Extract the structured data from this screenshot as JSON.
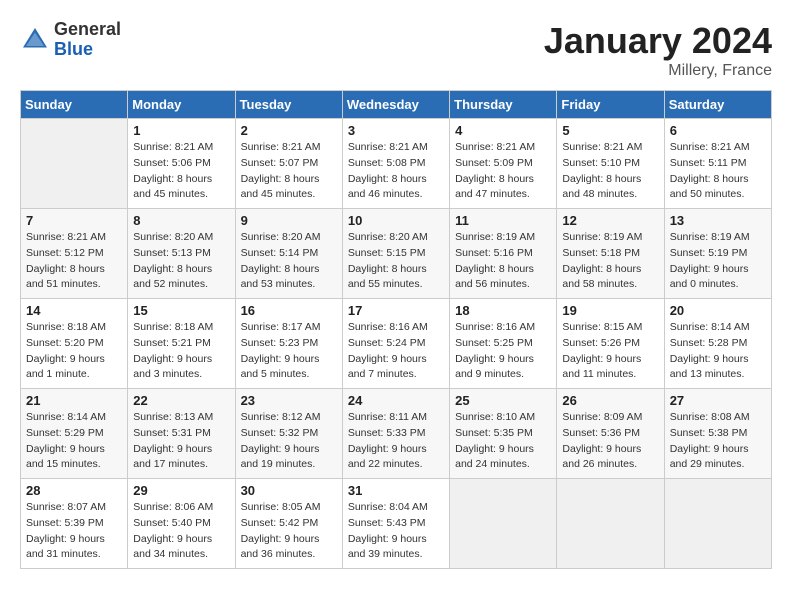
{
  "header": {
    "logo_general": "General",
    "logo_blue": "Blue",
    "month_title": "January 2024",
    "location": "Millery, France"
  },
  "columns": [
    "Sunday",
    "Monday",
    "Tuesday",
    "Wednesday",
    "Thursday",
    "Friday",
    "Saturday"
  ],
  "weeks": [
    [
      {
        "day": "",
        "empty": true
      },
      {
        "day": "1",
        "sunrise": "8:21 AM",
        "sunset": "5:06 PM",
        "daylight": "8 hours and 45 minutes."
      },
      {
        "day": "2",
        "sunrise": "8:21 AM",
        "sunset": "5:07 PM",
        "daylight": "8 hours and 45 minutes."
      },
      {
        "day": "3",
        "sunrise": "8:21 AM",
        "sunset": "5:08 PM",
        "daylight": "8 hours and 46 minutes."
      },
      {
        "day": "4",
        "sunrise": "8:21 AM",
        "sunset": "5:09 PM",
        "daylight": "8 hours and 47 minutes."
      },
      {
        "day": "5",
        "sunrise": "8:21 AM",
        "sunset": "5:10 PM",
        "daylight": "8 hours and 48 minutes."
      },
      {
        "day": "6",
        "sunrise": "8:21 AM",
        "sunset": "5:11 PM",
        "daylight": "8 hours and 50 minutes."
      }
    ],
    [
      {
        "day": "7",
        "sunrise": "8:21 AM",
        "sunset": "5:12 PM",
        "daylight": "8 hours and 51 minutes."
      },
      {
        "day": "8",
        "sunrise": "8:20 AM",
        "sunset": "5:13 PM",
        "daylight": "8 hours and 52 minutes."
      },
      {
        "day": "9",
        "sunrise": "8:20 AM",
        "sunset": "5:14 PM",
        "daylight": "8 hours and 53 minutes."
      },
      {
        "day": "10",
        "sunrise": "8:20 AM",
        "sunset": "5:15 PM",
        "daylight": "8 hours and 55 minutes."
      },
      {
        "day": "11",
        "sunrise": "8:19 AM",
        "sunset": "5:16 PM",
        "daylight": "8 hours and 56 minutes."
      },
      {
        "day": "12",
        "sunrise": "8:19 AM",
        "sunset": "5:18 PM",
        "daylight": "8 hours and 58 minutes."
      },
      {
        "day": "13",
        "sunrise": "8:19 AM",
        "sunset": "5:19 PM",
        "daylight": "9 hours and 0 minutes."
      }
    ],
    [
      {
        "day": "14",
        "sunrise": "8:18 AM",
        "sunset": "5:20 PM",
        "daylight": "9 hours and 1 minute."
      },
      {
        "day": "15",
        "sunrise": "8:18 AM",
        "sunset": "5:21 PM",
        "daylight": "9 hours and 3 minutes."
      },
      {
        "day": "16",
        "sunrise": "8:17 AM",
        "sunset": "5:23 PM",
        "daylight": "9 hours and 5 minutes."
      },
      {
        "day": "17",
        "sunrise": "8:16 AM",
        "sunset": "5:24 PM",
        "daylight": "9 hours and 7 minutes."
      },
      {
        "day": "18",
        "sunrise": "8:16 AM",
        "sunset": "5:25 PM",
        "daylight": "9 hours and 9 minutes."
      },
      {
        "day": "19",
        "sunrise": "8:15 AM",
        "sunset": "5:26 PM",
        "daylight": "9 hours and 11 minutes."
      },
      {
        "day": "20",
        "sunrise": "8:14 AM",
        "sunset": "5:28 PM",
        "daylight": "9 hours and 13 minutes."
      }
    ],
    [
      {
        "day": "21",
        "sunrise": "8:14 AM",
        "sunset": "5:29 PM",
        "daylight": "9 hours and 15 minutes."
      },
      {
        "day": "22",
        "sunrise": "8:13 AM",
        "sunset": "5:31 PM",
        "daylight": "9 hours and 17 minutes."
      },
      {
        "day": "23",
        "sunrise": "8:12 AM",
        "sunset": "5:32 PM",
        "daylight": "9 hours and 19 minutes."
      },
      {
        "day": "24",
        "sunrise": "8:11 AM",
        "sunset": "5:33 PM",
        "daylight": "9 hours and 22 minutes."
      },
      {
        "day": "25",
        "sunrise": "8:10 AM",
        "sunset": "5:35 PM",
        "daylight": "9 hours and 24 minutes."
      },
      {
        "day": "26",
        "sunrise": "8:09 AM",
        "sunset": "5:36 PM",
        "daylight": "9 hours and 26 minutes."
      },
      {
        "day": "27",
        "sunrise": "8:08 AM",
        "sunset": "5:38 PM",
        "daylight": "9 hours and 29 minutes."
      }
    ],
    [
      {
        "day": "28",
        "sunrise": "8:07 AM",
        "sunset": "5:39 PM",
        "daylight": "9 hours and 31 minutes."
      },
      {
        "day": "29",
        "sunrise": "8:06 AM",
        "sunset": "5:40 PM",
        "daylight": "9 hours and 34 minutes."
      },
      {
        "day": "30",
        "sunrise": "8:05 AM",
        "sunset": "5:42 PM",
        "daylight": "9 hours and 36 minutes."
      },
      {
        "day": "31",
        "sunrise": "8:04 AM",
        "sunset": "5:43 PM",
        "daylight": "9 hours and 39 minutes."
      },
      {
        "day": "",
        "empty": true
      },
      {
        "day": "",
        "empty": true
      },
      {
        "day": "",
        "empty": true
      }
    ]
  ]
}
